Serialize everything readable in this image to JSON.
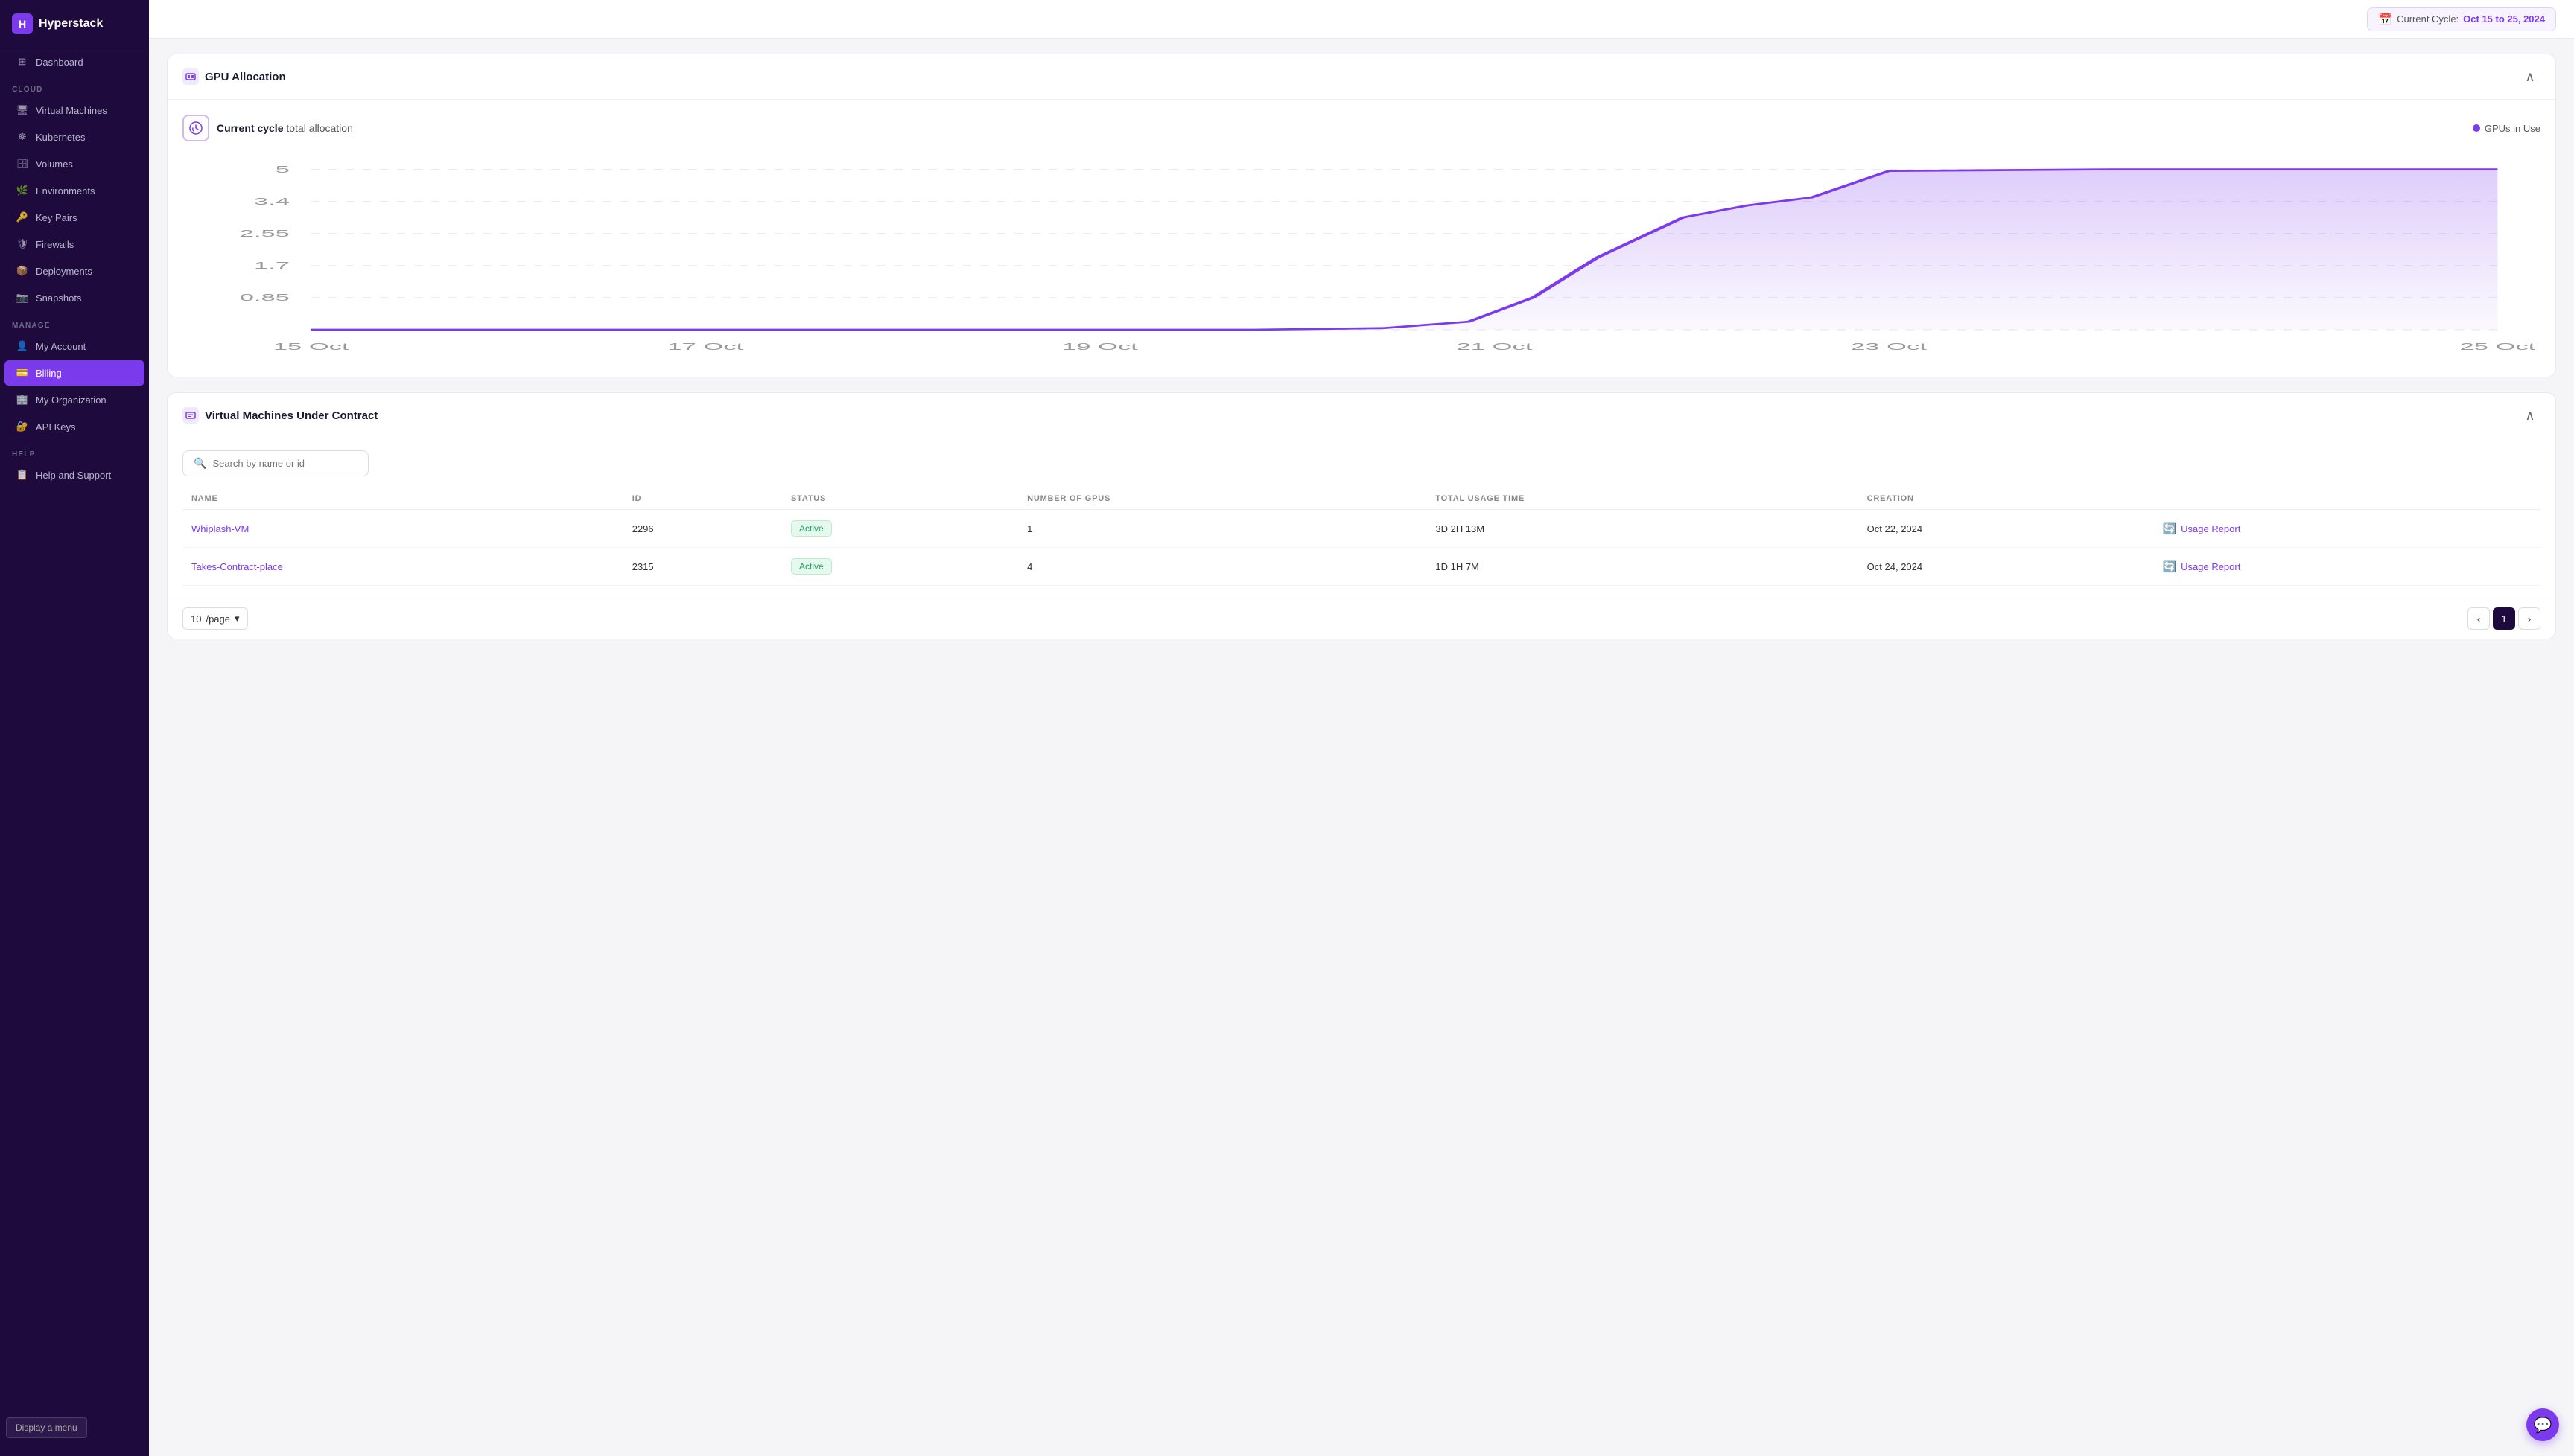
{
  "app": {
    "name": "Hyperstack",
    "logo_letter": "H"
  },
  "topbar": {
    "cycle_label": "Current Cycle:",
    "cycle_date": "Oct 15 to 25, 2024"
  },
  "sidebar": {
    "sections": [
      {
        "label": "",
        "items": [
          {
            "id": "dashboard",
            "label": "Dashboard",
            "icon": "⊞"
          }
        ]
      },
      {
        "label": "CLOUD",
        "items": [
          {
            "id": "virtual-machines",
            "label": "Virtual Machines",
            "icon": "🖥"
          },
          {
            "id": "kubernetes",
            "label": "Kubernetes",
            "icon": "☸"
          },
          {
            "id": "volumes",
            "label": "Volumes",
            "icon": "🗄"
          },
          {
            "id": "environments",
            "label": "Environments",
            "icon": "🌿"
          },
          {
            "id": "key-pairs",
            "label": "Key Pairs",
            "icon": "🔑"
          },
          {
            "id": "firewalls",
            "label": "Firewalls",
            "icon": "🛡"
          },
          {
            "id": "deployments",
            "label": "Deployments",
            "icon": "📦"
          },
          {
            "id": "snapshots",
            "label": "Snapshots",
            "icon": "📷"
          }
        ]
      },
      {
        "label": "MANAGE",
        "items": [
          {
            "id": "my-account",
            "label": "My Account",
            "icon": "👤"
          },
          {
            "id": "billing",
            "label": "Billing",
            "icon": "💳",
            "active": true
          },
          {
            "id": "my-organization",
            "label": "My Organization",
            "icon": "🏢"
          },
          {
            "id": "api-keys",
            "label": "API Keys",
            "icon": "🔐"
          }
        ]
      },
      {
        "label": "HELP",
        "items": [
          {
            "id": "help-support",
            "label": "Help and Support",
            "icon": "📋"
          }
        ]
      }
    ],
    "display_menu_label": "Display a menu"
  },
  "gpu_card": {
    "icon": "⬛",
    "title_bold": "GPU",
    "title_rest": " Allocation",
    "chart_title_bold": "Current cycle",
    "chart_title_rest": " total allocation",
    "legend_label": "GPUs in Use",
    "y_labels": [
      "5",
      "3.4",
      "2.55",
      "1.7",
      "0.85"
    ],
    "x_labels": [
      "15 Oct",
      "17 Oct",
      "19 Oct",
      "21 Oct",
      "23 Oct",
      "25 Oct"
    ]
  },
  "vm_card": {
    "icon": "⬛",
    "title_bold": "Virtual Machines",
    "title_rest": " Under Contract",
    "search_placeholder": "Search by name or id",
    "columns": [
      "NAME",
      "ID",
      "STATUS",
      "NUMBER OF GPUS",
      "TOTAL USAGE TIME",
      "CREATION",
      ""
    ],
    "rows": [
      {
        "name": "Whiplash-VM",
        "id": "2296",
        "status": "Active",
        "gpus": "1",
        "usage_time": "3D 2H 13M",
        "creation": "Oct 22, 2024",
        "action": "Usage Report"
      },
      {
        "name": "Takes-Contract-place",
        "id": "2315",
        "status": "Active",
        "gpus": "4",
        "usage_time": "1D 1H 7M",
        "creation": "Oct 24, 2024",
        "action": "Usage Report"
      }
    ],
    "per_page": "10",
    "current_page": "1"
  }
}
